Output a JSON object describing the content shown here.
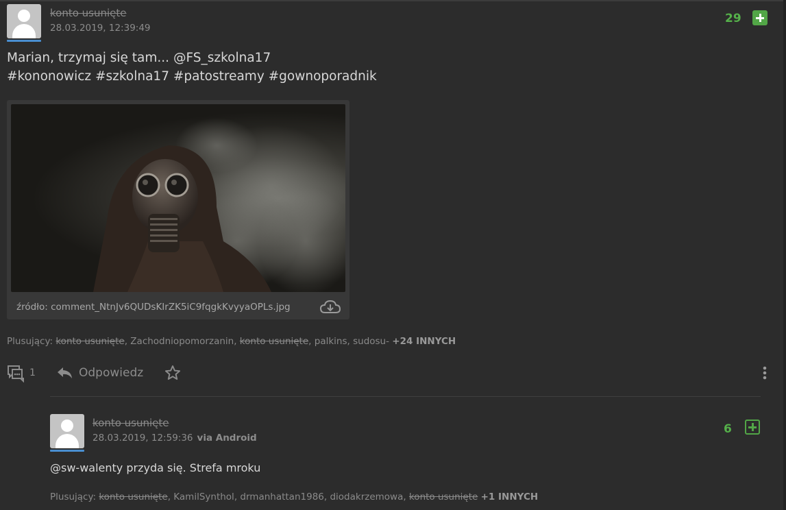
{
  "post": {
    "author": "konto usunięte",
    "date": "28.03.2019, 12:39:49",
    "score": "29",
    "text_line1": "Marian, trzymaj się tam... @FS_szkolna17",
    "text_line2": "#kononowicz #szkolna17 #patostreamy #gownoporadnik",
    "embed": {
      "source_label": "źródło:",
      "filename": "comment_NtnJv6QUDsKIrZK5iC9fqgkKvyyaOPLs.jpg"
    },
    "voters": {
      "label": "Plusujący:",
      "names": [
        "konto usunięte",
        "Zachodniopomorzanin",
        "konto usunięte",
        "palkins",
        "sudosu-"
      ],
      "more": "+24 INNYCH"
    },
    "actions": {
      "comments_count": "1",
      "reply_label": "Odpowiedz"
    }
  },
  "reply": {
    "author": "konto usunięte",
    "date": "28.03.2019, 12:59:36",
    "via": "via Android",
    "score": "6",
    "mention": "@sw-walenty",
    "text": " przyda się. Strefa mroku",
    "voters": {
      "label": "Plusujący:",
      "names": [
        "konto usunięte",
        "KamilSynthol",
        "drmanhattan1986",
        "diodakrzemowa",
        "konto usunięte"
      ],
      "more": "+1 INNYCH"
    }
  },
  "colors": {
    "background": "#2c2c2c",
    "score_green": "#55b04a",
    "avatar_underline": "#4a8fd1"
  }
}
